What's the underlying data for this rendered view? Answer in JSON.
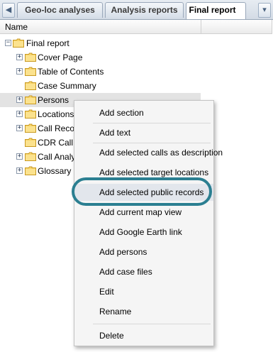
{
  "nav": {
    "back_glyph": "◀",
    "more_glyph": "▾"
  },
  "tabs": [
    {
      "label": "Geo-loc analyses"
    },
    {
      "label": "Analysis reports"
    },
    {
      "label": "Final report",
      "active": true,
      "close_glyph": "✕"
    }
  ],
  "column_header": {
    "name": "Name"
  },
  "tree": [
    {
      "label": "Final report",
      "expander": "−"
    },
    {
      "label": "Cover Page",
      "expander": "+"
    },
    {
      "label": "Table of Contents",
      "expander": "+"
    },
    {
      "label": "Case Summary",
      "expander": ""
    },
    {
      "label": "Persons",
      "expander": "+"
    },
    {
      "label": "Locations",
      "expander": "+"
    },
    {
      "label": "Call Records",
      "expander": "+"
    },
    {
      "label": "CDR Call Map",
      "expander": ""
    },
    {
      "label": "Call Analysis",
      "expander": "+"
    },
    {
      "label": "Glossary",
      "expander": "+"
    }
  ],
  "context_menu": [
    {
      "label": "Add section"
    },
    {
      "label": "Add text"
    },
    {
      "label": "Add selected calls as description"
    },
    {
      "label": "Add selected target locations"
    },
    {
      "label": "Add selected public records"
    },
    {
      "label": "Add current map view"
    },
    {
      "label": "Add Google Earth link"
    },
    {
      "label": "Add persons"
    },
    {
      "label": "Add case files"
    },
    {
      "label": "Edit"
    },
    {
      "label": "Rename"
    },
    {
      "label": "Delete"
    }
  ],
  "colors": {
    "highlight_ring": "#2b7f91",
    "folder_fill": "#f7d46a",
    "folder_edge": "#c99a22",
    "selected_row": "#e3e3e3",
    "menu_bg": "#f5f5f5"
  },
  "icons": {
    "folder": "folder-icon",
    "expand": "plus-box-icon",
    "collapse": "minus-box-icon"
  }
}
